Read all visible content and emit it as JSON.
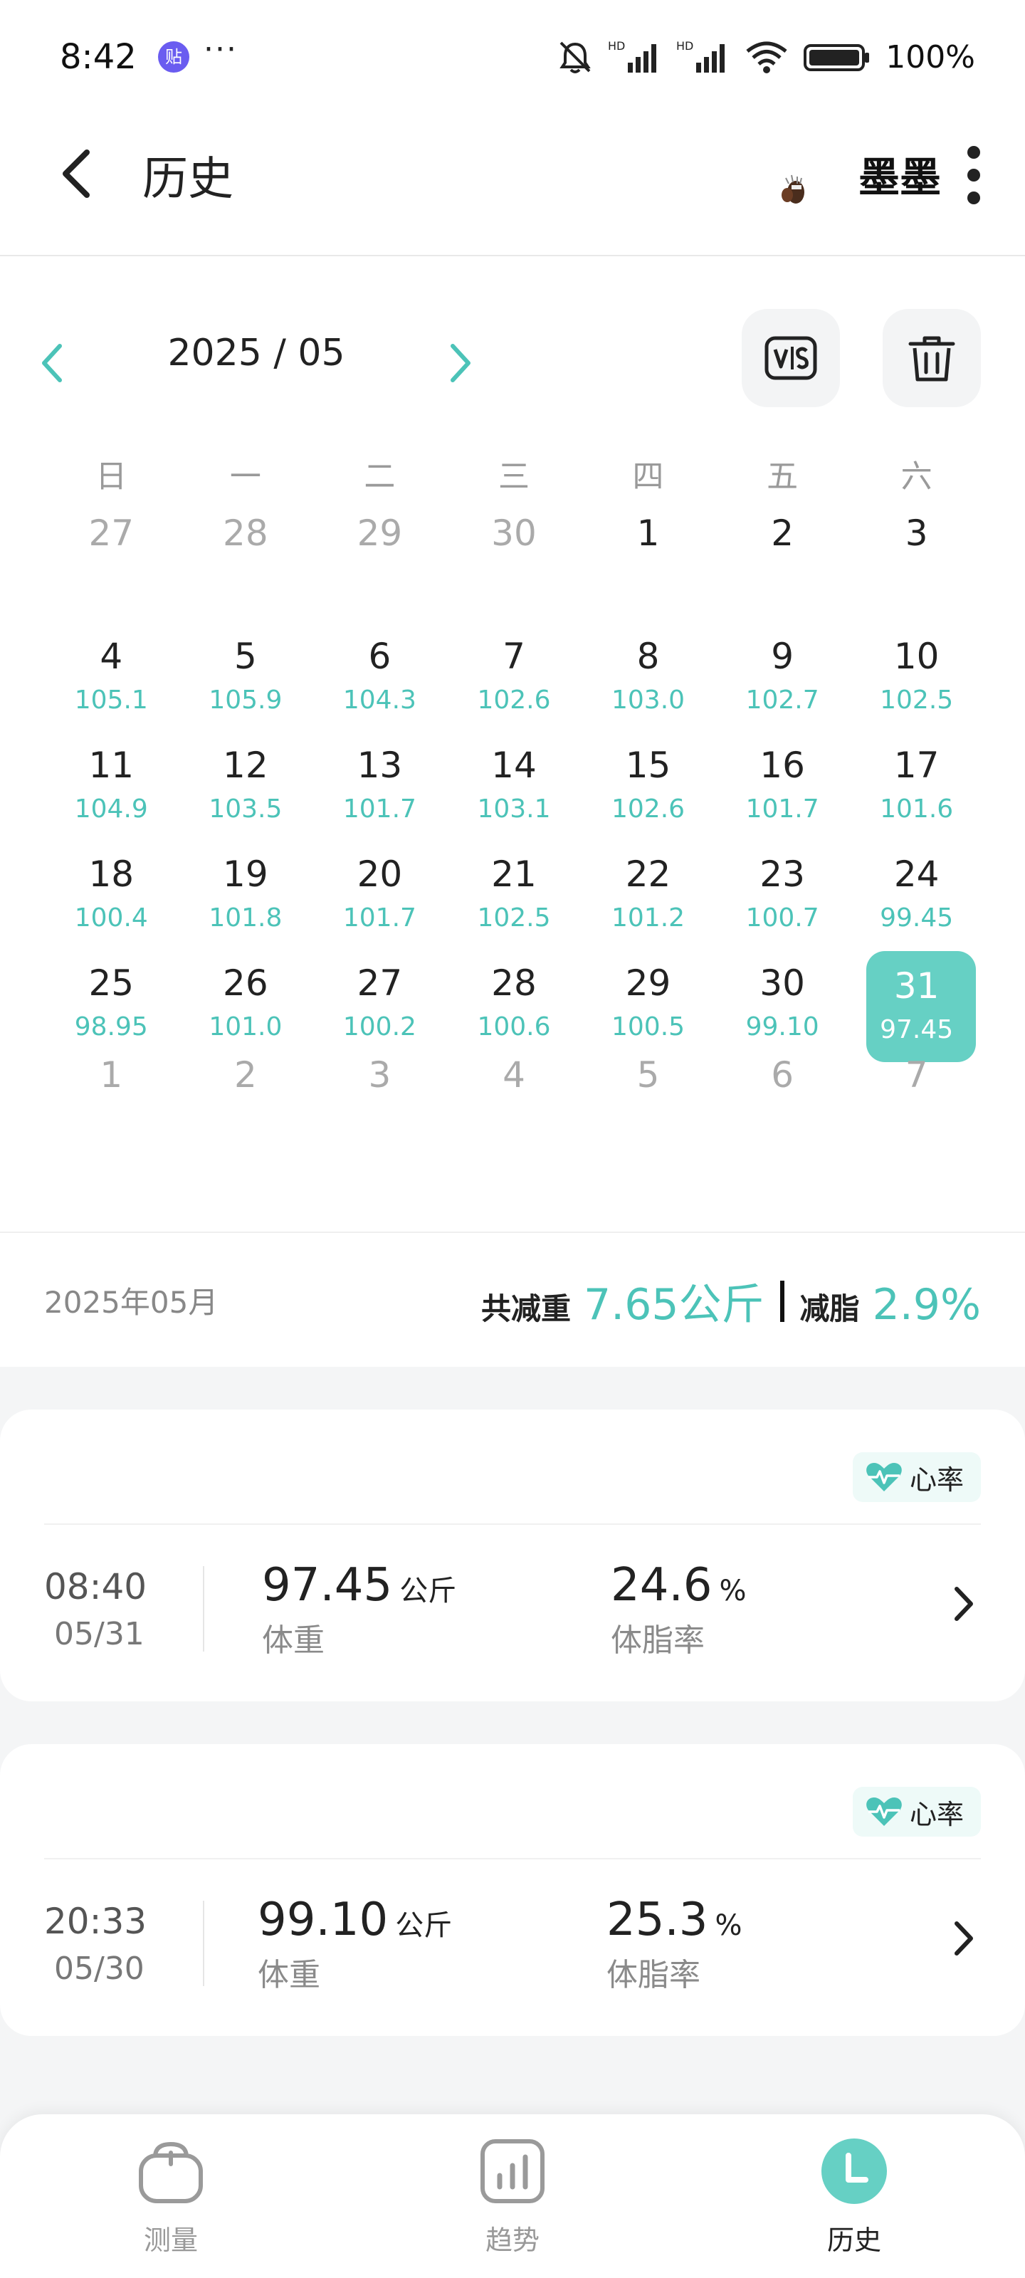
{
  "status_bar": {
    "time": "8:42",
    "app_badge": "贴",
    "dots": "···",
    "network_1": "HD",
    "network_2": "HD",
    "battery": "100%"
  },
  "header": {
    "title": "历史",
    "user_name": "墨墨"
  },
  "calendar": {
    "month_label": "2025 / 05",
    "accent_color": "#4cc3b8",
    "weekdays": [
      "日",
      "一",
      "二",
      "三",
      "四",
      "五",
      "六"
    ],
    "weeks": [
      [
        {
          "d": "27",
          "v": "",
          "out": true
        },
        {
          "d": "28",
          "v": "",
          "out": true
        },
        {
          "d": "29",
          "v": "",
          "out": true
        },
        {
          "d": "30",
          "v": "",
          "out": true
        },
        {
          "d": "1",
          "v": ""
        },
        {
          "d": "2",
          "v": ""
        },
        {
          "d": "3",
          "v": ""
        }
      ],
      [
        {
          "d": "4",
          "v": "105.1"
        },
        {
          "d": "5",
          "v": "105.9"
        },
        {
          "d": "6",
          "v": "104.3"
        },
        {
          "d": "7",
          "v": "102.6"
        },
        {
          "d": "8",
          "v": "103.0"
        },
        {
          "d": "9",
          "v": "102.7"
        },
        {
          "d": "10",
          "v": "102.5"
        }
      ],
      [
        {
          "d": "11",
          "v": "104.9"
        },
        {
          "d": "12",
          "v": "103.5"
        },
        {
          "d": "13",
          "v": "101.7"
        },
        {
          "d": "14",
          "v": "103.1"
        },
        {
          "d": "15",
          "v": "102.6"
        },
        {
          "d": "16",
          "v": "101.7"
        },
        {
          "d": "17",
          "v": "101.6"
        }
      ],
      [
        {
          "d": "18",
          "v": "100.4"
        },
        {
          "d": "19",
          "v": "101.8"
        },
        {
          "d": "20",
          "v": "101.7"
        },
        {
          "d": "21",
          "v": "102.5"
        },
        {
          "d": "22",
          "v": "101.2"
        },
        {
          "d": "23",
          "v": "100.7"
        },
        {
          "d": "24",
          "v": "99.45"
        }
      ],
      [
        {
          "d": "25",
          "v": "98.95"
        },
        {
          "d": "26",
          "v": "101.0"
        },
        {
          "d": "27",
          "v": "100.2"
        },
        {
          "d": "28",
          "v": "100.6"
        },
        {
          "d": "29",
          "v": "100.5"
        },
        {
          "d": "30",
          "v": "99.10"
        },
        {
          "d": "31",
          "v": "97.45",
          "selected": true
        }
      ],
      [
        {
          "d": "1",
          "v": "",
          "out": true
        },
        {
          "d": "2",
          "v": "",
          "out": true
        },
        {
          "d": "3",
          "v": "",
          "out": true
        },
        {
          "d": "4",
          "v": "",
          "out": true
        },
        {
          "d": "5",
          "v": "",
          "out": true
        },
        {
          "d": "6",
          "v": "",
          "out": true
        },
        {
          "d": "7",
          "v": "",
          "out": true
        }
      ]
    ]
  },
  "summary": {
    "month": "2025年05月",
    "weight_label": "共减重",
    "weight_value": "7.65公斤",
    "fat_label": "减脂",
    "fat_value": "2.9%"
  },
  "records": [
    {
      "tag": "心率",
      "time": "08:40",
      "date": "05/31",
      "weight_value": "97.45",
      "weight_unit": "公斤",
      "weight_label": "体重",
      "fat_value": "24.6",
      "fat_unit": "%",
      "fat_label": "体脂率"
    },
    {
      "tag": "心率",
      "time": "20:33",
      "date": "05/30",
      "weight_value": "99.10",
      "weight_unit": "公斤",
      "weight_label": "体重",
      "fat_value": "25.3",
      "fat_unit": "%",
      "fat_label": "体脂率"
    }
  ],
  "bottom_nav": {
    "items": [
      {
        "label": "测量",
        "icon": "scale-icon"
      },
      {
        "label": "趋势",
        "icon": "chart-icon"
      },
      {
        "label": "历史",
        "icon": "history-icon",
        "active": true
      }
    ]
  }
}
